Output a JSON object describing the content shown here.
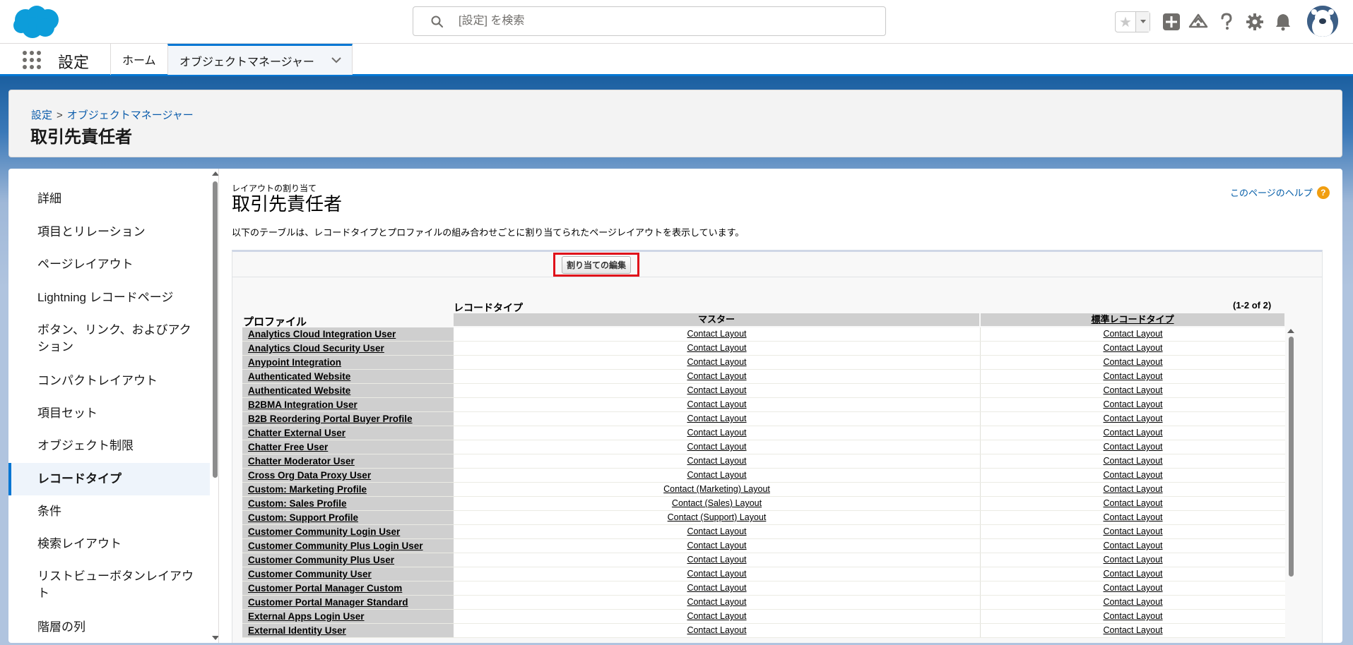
{
  "header": {
    "search_placeholder": "[設定] を検索"
  },
  "nav": {
    "app_name": "設定",
    "home_label": "ホーム",
    "active_tab_label": "オブジェクトマネージャー"
  },
  "page_header": {
    "breadcrumb": [
      "設定",
      "オブジェクトマネージャー"
    ],
    "breadcrumb_sep": ">",
    "title": "取引先責任者"
  },
  "sidebar": {
    "items": [
      {
        "label": "詳細"
      },
      {
        "label": "項目とリレーション"
      },
      {
        "label": "ページレイアウト"
      },
      {
        "label": "Lightning レコードページ"
      },
      {
        "label": "ボタン、リンク、およびアク\nション"
      },
      {
        "label": "コンパクトレイアウト"
      },
      {
        "label": "項目セット"
      },
      {
        "label": "オブジェクト制限"
      },
      {
        "label": "レコードタイプ",
        "active": true
      },
      {
        "label": "条件"
      },
      {
        "label": "検索レイアウト"
      },
      {
        "label": "リストビューボタンレイアウ\nト"
      },
      {
        "label": "階層の列"
      }
    ]
  },
  "content": {
    "subtitle": "レイアウトの割り当て",
    "title": "取引先責任者",
    "help_link": "このページのヘルプ",
    "help_icon": "?",
    "description": "以下のテーブルは、レコードタイプとプロファイルの組み合わせごとに割り当てられたページレイアウトを表示しています。",
    "edit_button": "割り当ての編集",
    "record_type_label": "レコードタイプ",
    "count_label": "(1-2 of 2)",
    "profile_label": "プロファイル",
    "columns": [
      "マスター",
      "標準レコードタイプ"
    ],
    "rows": [
      {
        "profile": "Analytics Cloud Integration User",
        "master": "Contact Layout",
        "standard": "Contact Layout"
      },
      {
        "profile": "Analytics Cloud Security User",
        "master": "Contact Layout",
        "standard": "Contact Layout"
      },
      {
        "profile": "Anypoint Integration",
        "master": "Contact Layout",
        "standard": "Contact Layout"
      },
      {
        "profile": "Authenticated Website",
        "master": "Contact Layout",
        "standard": "Contact Layout"
      },
      {
        "profile": "Authenticated Website",
        "master": "Contact Layout",
        "standard": "Contact Layout"
      },
      {
        "profile": "B2BMA Integration User",
        "master": "Contact Layout",
        "standard": "Contact Layout"
      },
      {
        "profile": "B2B Reordering Portal Buyer Profile",
        "master": "Contact Layout",
        "standard": "Contact Layout"
      },
      {
        "profile": "Chatter External User",
        "master": "Contact Layout",
        "standard": "Contact Layout"
      },
      {
        "profile": "Chatter Free User",
        "master": "Contact Layout",
        "standard": "Contact Layout"
      },
      {
        "profile": "Chatter Moderator User",
        "master": "Contact Layout",
        "standard": "Contact Layout"
      },
      {
        "profile": "Cross Org Data Proxy User",
        "master": "Contact Layout",
        "standard": "Contact Layout"
      },
      {
        "profile": "Custom: Marketing Profile",
        "master": "Contact (Marketing) Layout",
        "standard": "Contact Layout"
      },
      {
        "profile": "Custom: Sales Profile",
        "master": "Contact (Sales) Layout",
        "standard": "Contact Layout"
      },
      {
        "profile": "Custom: Support Profile",
        "master": "Contact (Support) Layout",
        "standard": "Contact Layout"
      },
      {
        "profile": "Customer Community Login User",
        "master": "Contact Layout",
        "standard": "Contact Layout"
      },
      {
        "profile": "Customer Community Plus Login User",
        "master": "Contact Layout",
        "standard": "Contact Layout"
      },
      {
        "profile": "Customer Community Plus User",
        "master": "Contact Layout",
        "standard": "Contact Layout"
      },
      {
        "profile": "Customer Community User",
        "master": "Contact Layout",
        "standard": "Contact Layout"
      },
      {
        "profile": "Customer Portal Manager Custom",
        "master": "Contact Layout",
        "standard": "Contact Layout"
      },
      {
        "profile": "Customer Portal Manager Standard",
        "master": "Contact Layout",
        "standard": "Contact Layout"
      },
      {
        "profile": "External Apps Login User",
        "master": "Contact Layout",
        "standard": "Contact Layout"
      },
      {
        "profile": "External Identity User",
        "master": "Contact Layout",
        "standard": "Contact Layout"
      }
    ]
  },
  "colors": {
    "brand_blue": "#0176d3",
    "link_blue": "#0b5cab",
    "highlight_red": "#e0101a",
    "help_orange": "#f19e10"
  }
}
